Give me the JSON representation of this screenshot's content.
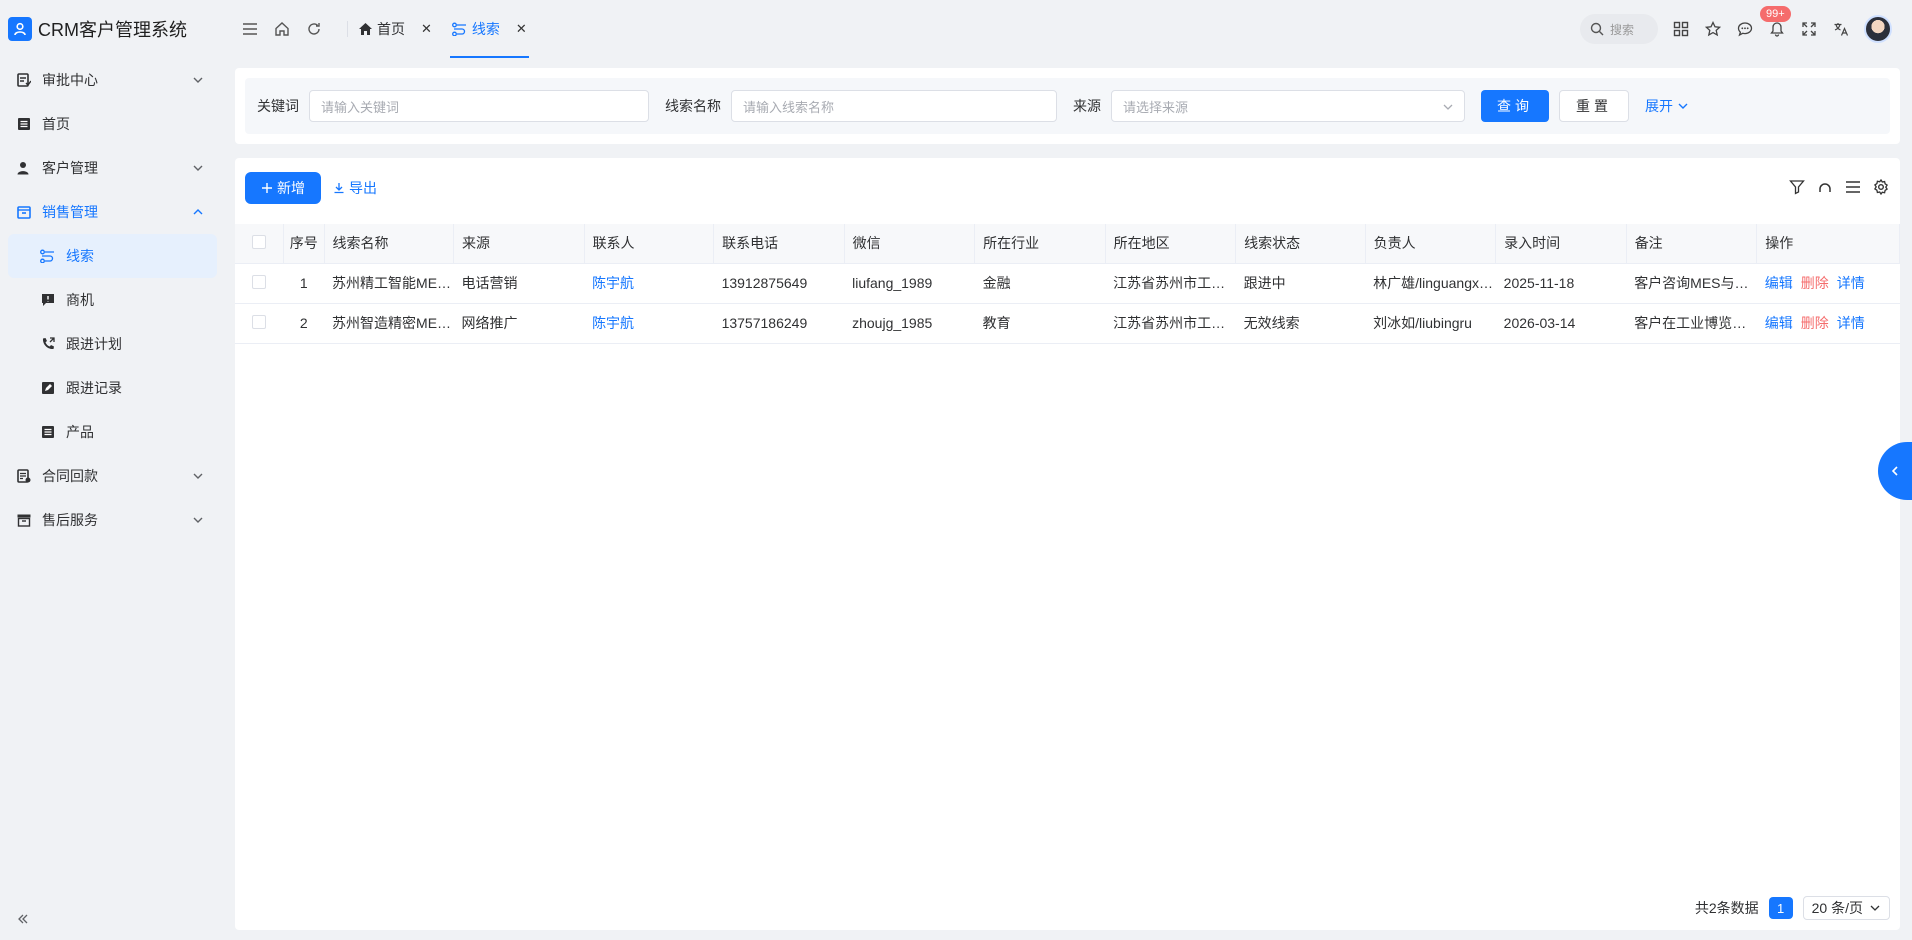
{
  "app": {
    "title": "CRM客户管理系统"
  },
  "sidebar": {
    "items": [
      {
        "label": "审批中心"
      },
      {
        "label": "首页"
      },
      {
        "label": "客户管理"
      },
      {
        "label": "销售管理"
      },
      {
        "label": "合同回款"
      },
      {
        "label": "售后服务"
      }
    ],
    "sales_sub": [
      {
        "label": "线索"
      },
      {
        "label": "商机"
      },
      {
        "label": "跟进计划"
      },
      {
        "label": "跟进记录"
      },
      {
        "label": "产品"
      }
    ]
  },
  "tabs": [
    {
      "label": "首页"
    },
    {
      "label": "线索"
    }
  ],
  "topbar": {
    "search_label": "搜索",
    "notification_badge": "99+"
  },
  "filter": {
    "keyword_label": "关键词",
    "keyword_placeholder": "请输入关键词",
    "name_label": "线索名称",
    "name_placeholder": "请输入线索名称",
    "source_label": "来源",
    "source_placeholder": "请选择来源",
    "query_button": "查询",
    "reset_button": "重置",
    "expand_link": "展开"
  },
  "toolbar": {
    "add_button": "新增",
    "export_button": "导出"
  },
  "table": {
    "columns": [
      "序号",
      "线索名称",
      "来源",
      "联系人",
      "联系电话",
      "微信",
      "所在行业",
      "所在地区",
      "线索状态",
      "负责人",
      "录入时间",
      "备注",
      "操作"
    ],
    "rows": [
      {
        "index": "1",
        "name": "苏州精工智能MES系统升级",
        "source": "电话营销",
        "contact": "陈宇航",
        "phone": "13912875649",
        "wechat": "liufang_1989",
        "industry": "金融",
        "region": "江苏省苏州市工业园区",
        "status": "跟进中",
        "owner": "林广雄/linguangxiong",
        "date": "2025-11-18",
        "remark": "客户咨询MES与ERP对接"
      },
      {
        "index": "2",
        "name": "苏州智造精密MES项目",
        "source": "网络推广",
        "contact": "陈宇航",
        "phone": "13757186249",
        "wechat": "zhoujg_1985",
        "industry": "教育",
        "region": "江苏省苏州市工业园区",
        "status": "无效线索",
        "owner": "刘冰如/liubingru",
        "date": "2026-03-14",
        "remark": "客户在工业博览会留资"
      }
    ],
    "ops": {
      "edit": "编辑",
      "delete": "删除",
      "detail": "详情"
    }
  },
  "pager": {
    "total_text": "共2条数据",
    "current_page": "1",
    "page_size": "20 条/页"
  },
  "colors": {
    "primary": "#1677ff",
    "danger": "#f56c6c",
    "bg": "#f0f2f5"
  }
}
